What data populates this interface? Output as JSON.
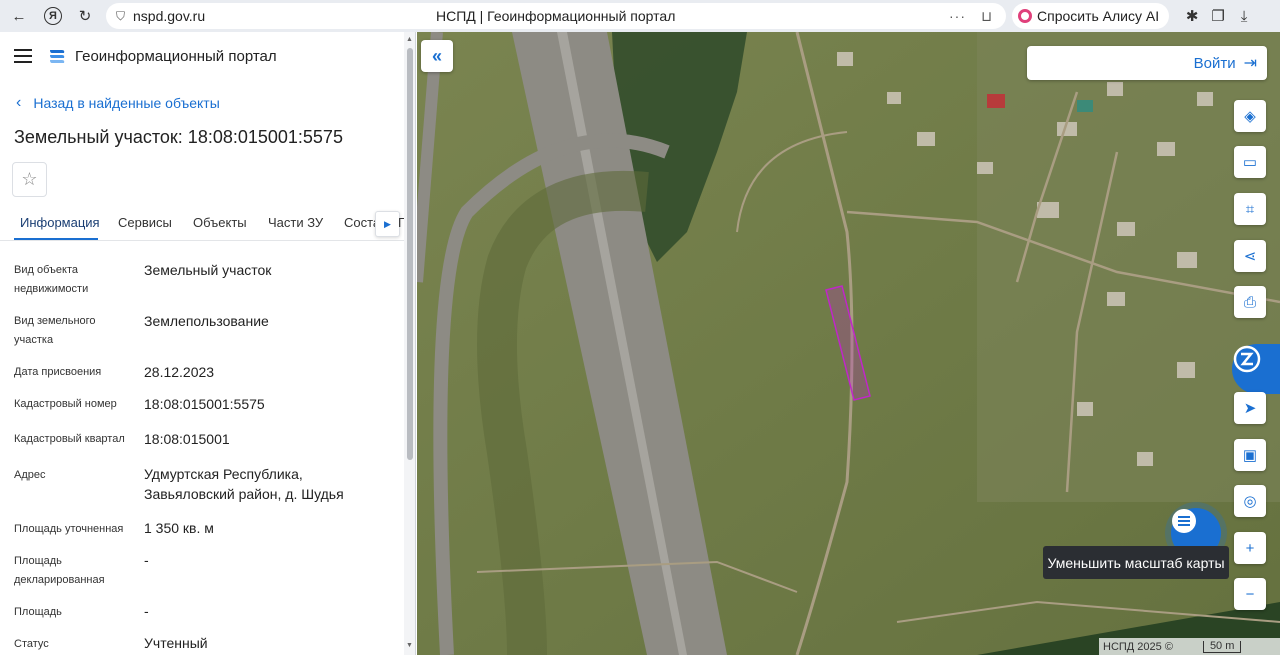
{
  "browser": {
    "url": "nspd.gov.ru",
    "tab_title": "НСПД | Геоинформационный портал",
    "alice_label": "Спросить Алису AI",
    "menu_dots": "···"
  },
  "sidebar": {
    "portal_title": "Геоинформационный портал",
    "back_label": "Назад в найденные объекты",
    "object_title": "Земельный участок: 18:08:015001:5575",
    "tabs": [
      {
        "label": "Информация",
        "active": true
      },
      {
        "label": "Сервисы"
      },
      {
        "label": "Объекты"
      },
      {
        "label": "Части ЗУ"
      },
      {
        "label": "Соста"
      }
    ],
    "tab_overflow": "Г",
    "properties": [
      {
        "label": "Вид объекта недвижимости",
        "value": "Земельный участок"
      },
      {
        "label": "Вид земельного участка",
        "value": "Землепользование"
      },
      {
        "label": "Дата присвоения",
        "value": "28.12.2023"
      },
      {
        "label": "Кадастровый номер",
        "value": "18:08:015001:5575"
      },
      {
        "label": "Кадастровый квартал",
        "value": "18:08:015001"
      },
      {
        "label": "Адрес",
        "value": "Удмуртская Республика, Завьяловский район, д. Шудья"
      },
      {
        "label": "Площадь уточненная",
        "value": "1 350 кв. м"
      },
      {
        "label": "Площадь декларированная",
        "value": "-"
      },
      {
        "label": "Площадь",
        "value": "-"
      },
      {
        "label": "Статус",
        "value": "Учтенный"
      }
    ]
  },
  "map": {
    "login_label": "Войти",
    "tooltip": "Уменьшить масштаб карты",
    "attribution": "НСПД 2025 ©",
    "scale_label": "50 m",
    "parcel_color": "#c026c9"
  }
}
